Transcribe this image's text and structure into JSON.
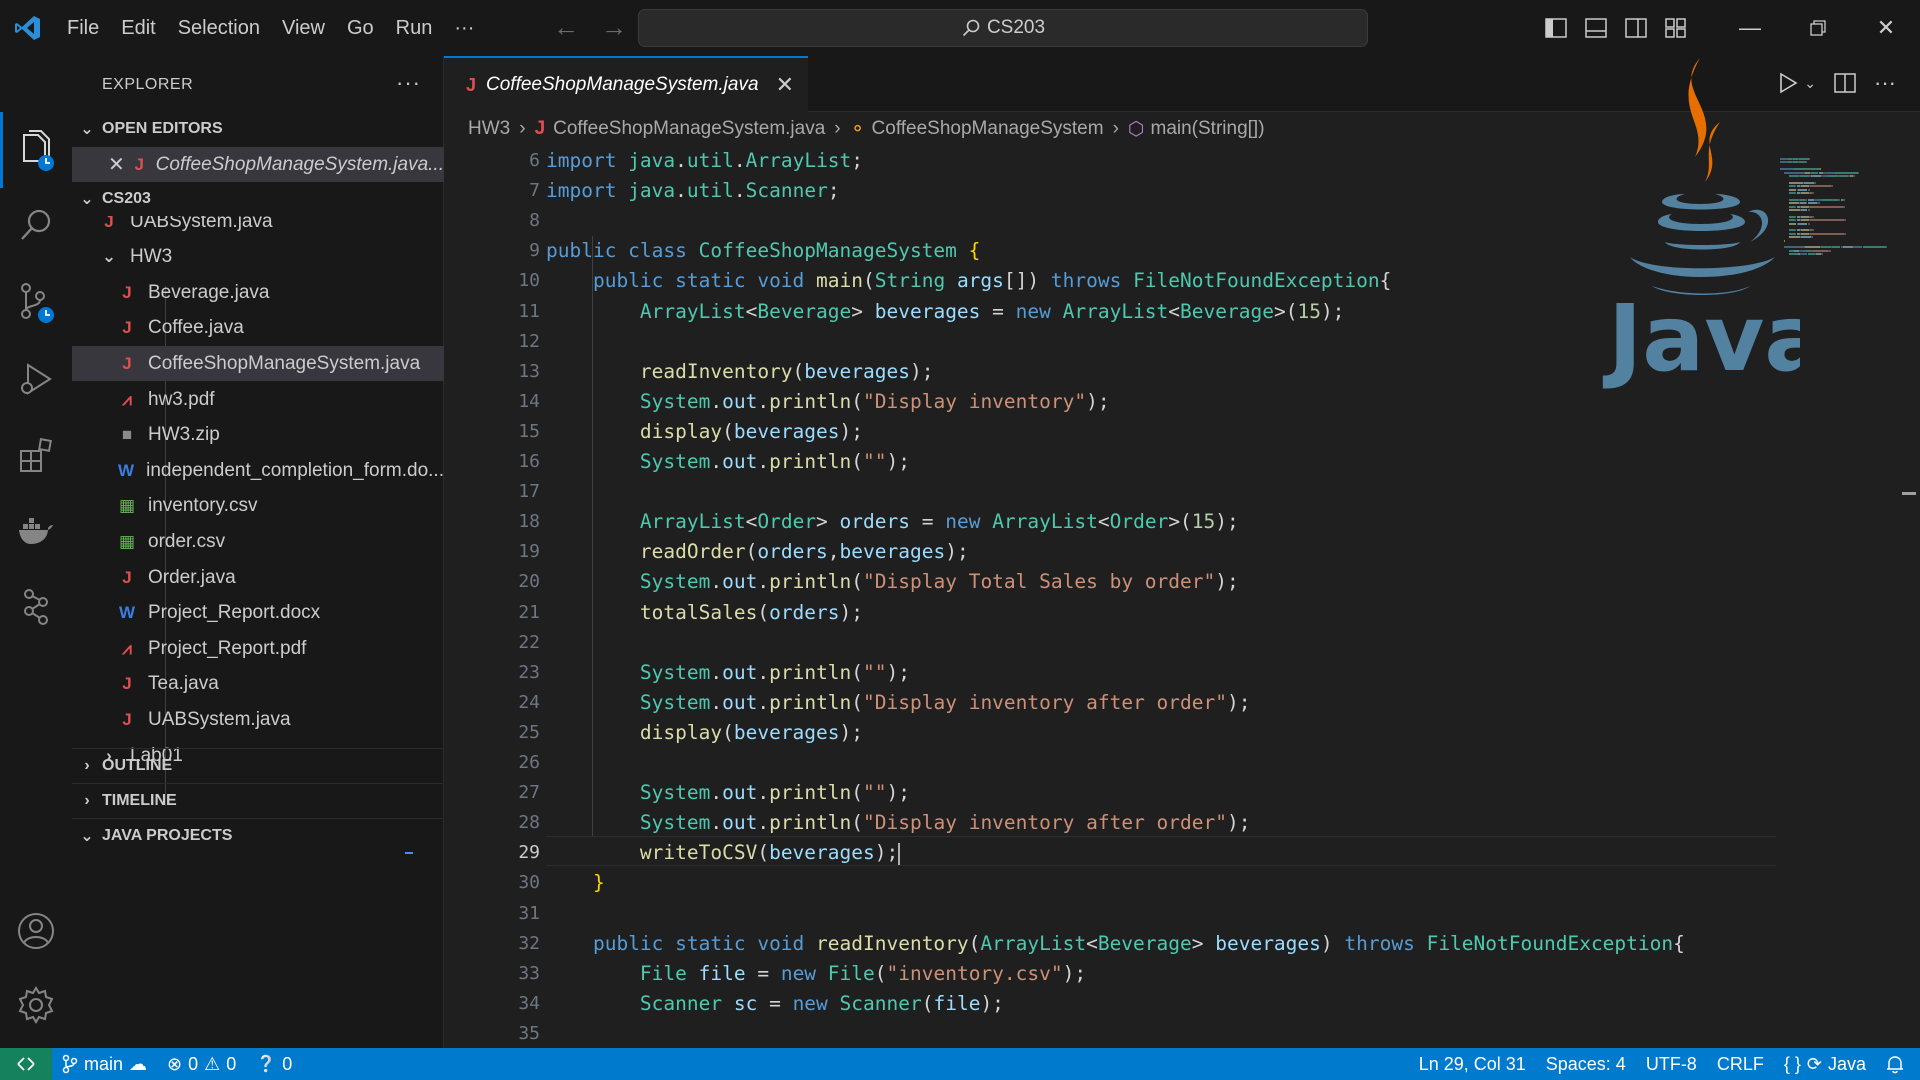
{
  "titlebar": {
    "menu": [
      "File",
      "Edit",
      "Selection",
      "View",
      "Go",
      "Run",
      "···"
    ],
    "search": "CS203"
  },
  "sidebar": {
    "header": "EXPLORER",
    "open_editors_label": "OPEN EDITORS",
    "open_editor_file": "CoffeeShopManageSystem.java...",
    "workspace_label": "CS203",
    "rows": [
      {
        "label": "UABSystem.java",
        "type": "java"
      },
      {
        "label": "HW3",
        "type": "folder"
      },
      {
        "label": "Beverage.java",
        "type": "java"
      },
      {
        "label": "Coffee.java",
        "type": "java"
      },
      {
        "label": "CoffeeShopManageSystem.java",
        "type": "java"
      },
      {
        "label": "hw3.pdf",
        "type": "pdf"
      },
      {
        "label": "HW3.zip",
        "type": "zip"
      },
      {
        "label": "independent_completion_form.do...",
        "type": "word"
      },
      {
        "label": "inventory.csv",
        "type": "csv"
      },
      {
        "label": "order.csv",
        "type": "csv"
      },
      {
        "label": "Order.java",
        "type": "java"
      },
      {
        "label": "Project_Report.docx",
        "type": "word"
      },
      {
        "label": "Project_Report.pdf",
        "type": "pdf"
      },
      {
        "label": "Tea.java",
        "type": "java"
      },
      {
        "label": "UABSystem.java",
        "type": "java"
      },
      {
        "label": "Lab01",
        "type": "folder-collapsed"
      }
    ],
    "outline_label": "OUTLINE",
    "timeline_label": "TIMELINE",
    "java_projects_label": "JAVA PROJECTS"
  },
  "editor": {
    "tab_label": "CoffeeShopManageSystem.java",
    "breadcrumbs": [
      "HW3",
      "CoffeeShopManageSystem.java",
      "CoffeeShopManageSystem",
      "main(String[])"
    ],
    "active_line": 29,
    "line_numbers": [
      "6",
      "7",
      "8",
      "9",
      "10",
      "11",
      "12",
      "13",
      "14",
      "15",
      "16",
      "17",
      "18",
      "19",
      "20",
      "21",
      "22",
      "23",
      "24",
      "25",
      "26",
      "27",
      "28",
      "29",
      "30",
      "31",
      "32",
      "33",
      "34",
      "35"
    ],
    "code": [
      [
        [
          "kw",
          "import "
        ],
        [
          "ty",
          "java"
        ],
        [
          "tx",
          "."
        ],
        [
          "ty",
          "util"
        ],
        [
          "tx",
          "."
        ],
        [
          "ty",
          "ArrayList"
        ],
        [
          "tx",
          ";"
        ]
      ],
      [
        [
          "kw",
          "import "
        ],
        [
          "ty",
          "java"
        ],
        [
          "tx",
          "."
        ],
        [
          "ty",
          "util"
        ],
        [
          "tx",
          "."
        ],
        [
          "ty",
          "Scanner"
        ],
        [
          "tx",
          ";"
        ]
      ],
      [],
      [
        [
          "kw",
          "public class "
        ],
        [
          "ty",
          "CoffeeShopManageSystem "
        ],
        [
          "br",
          "{"
        ]
      ],
      [
        [
          "tx",
          "    "
        ],
        [
          "kw",
          "public static void "
        ],
        [
          "fn",
          "main"
        ],
        [
          "tx",
          "("
        ],
        [
          "ty",
          "String "
        ],
        [
          "va",
          "args"
        ],
        [
          "tx",
          "[]) "
        ],
        [
          "kw",
          "throws "
        ],
        [
          "ty",
          "FileNotFoundException"
        ],
        [
          "tx",
          "{"
        ]
      ],
      [
        [
          "tx",
          "        "
        ],
        [
          "ty",
          "ArrayList"
        ],
        [
          "tx",
          "<"
        ],
        [
          "ty",
          "Beverage"
        ],
        [
          "tx",
          "> "
        ],
        [
          "va",
          "beverages"
        ],
        [
          "tx",
          " = "
        ],
        [
          "kw",
          "new "
        ],
        [
          "ty",
          "ArrayList"
        ],
        [
          "tx",
          "<"
        ],
        [
          "ty",
          "Beverage"
        ],
        [
          "tx",
          ">("
        ],
        [
          "nm",
          "15"
        ],
        [
          "tx",
          ");"
        ]
      ],
      [],
      [
        [
          "tx",
          "        "
        ],
        [
          "fn",
          "readInventory"
        ],
        [
          "tx",
          "("
        ],
        [
          "va",
          "beverages"
        ],
        [
          "tx",
          ");"
        ]
      ],
      [
        [
          "tx",
          "        "
        ],
        [
          "ty",
          "System"
        ],
        [
          "tx",
          "."
        ],
        [
          "va",
          "out"
        ],
        [
          "tx",
          "."
        ],
        [
          "fn",
          "println"
        ],
        [
          "tx",
          "("
        ],
        [
          "st",
          "\"Display inventory\""
        ],
        [
          "tx",
          ");"
        ]
      ],
      [
        [
          "tx",
          "        "
        ],
        [
          "fn",
          "display"
        ],
        [
          "tx",
          "("
        ],
        [
          "va",
          "beverages"
        ],
        [
          "tx",
          ");"
        ]
      ],
      [
        [
          "tx",
          "        "
        ],
        [
          "ty",
          "System"
        ],
        [
          "tx",
          "."
        ],
        [
          "va",
          "out"
        ],
        [
          "tx",
          "."
        ],
        [
          "fn",
          "println"
        ],
        [
          "tx",
          "("
        ],
        [
          "st",
          "\"\""
        ],
        [
          "tx",
          ");"
        ]
      ],
      [],
      [
        [
          "tx",
          "        "
        ],
        [
          "ty",
          "ArrayList"
        ],
        [
          "tx",
          "<"
        ],
        [
          "ty",
          "Order"
        ],
        [
          "tx",
          "> "
        ],
        [
          "va",
          "orders"
        ],
        [
          "tx",
          " = "
        ],
        [
          "kw",
          "new "
        ],
        [
          "ty",
          "ArrayList"
        ],
        [
          "tx",
          "<"
        ],
        [
          "ty",
          "Order"
        ],
        [
          "tx",
          ">("
        ],
        [
          "nm",
          "15"
        ],
        [
          "tx",
          ");"
        ]
      ],
      [
        [
          "tx",
          "        "
        ],
        [
          "fn",
          "readOrder"
        ],
        [
          "tx",
          "("
        ],
        [
          "va",
          "orders"
        ],
        [
          "tx",
          ","
        ],
        [
          "va",
          "beverages"
        ],
        [
          "tx",
          ");"
        ]
      ],
      [
        [
          "tx",
          "        "
        ],
        [
          "ty",
          "System"
        ],
        [
          "tx",
          "."
        ],
        [
          "va",
          "out"
        ],
        [
          "tx",
          "."
        ],
        [
          "fn",
          "println"
        ],
        [
          "tx",
          "("
        ],
        [
          "st",
          "\"Display Total Sales by order\""
        ],
        [
          "tx",
          ");"
        ]
      ],
      [
        [
          "tx",
          "        "
        ],
        [
          "fn",
          "totalSales"
        ],
        [
          "tx",
          "("
        ],
        [
          "va",
          "orders"
        ],
        [
          "tx",
          ");"
        ]
      ],
      [],
      [
        [
          "tx",
          "        "
        ],
        [
          "ty",
          "System"
        ],
        [
          "tx",
          "."
        ],
        [
          "va",
          "out"
        ],
        [
          "tx",
          "."
        ],
        [
          "fn",
          "println"
        ],
        [
          "tx",
          "("
        ],
        [
          "st",
          "\"\""
        ],
        [
          "tx",
          ");"
        ]
      ],
      [
        [
          "tx",
          "        "
        ],
        [
          "ty",
          "System"
        ],
        [
          "tx",
          "."
        ],
        [
          "va",
          "out"
        ],
        [
          "tx",
          "."
        ],
        [
          "fn",
          "println"
        ],
        [
          "tx",
          "("
        ],
        [
          "st",
          "\"Display inventory after order\""
        ],
        [
          "tx",
          ");"
        ]
      ],
      [
        [
          "tx",
          "        "
        ],
        [
          "fn",
          "display"
        ],
        [
          "tx",
          "("
        ],
        [
          "va",
          "beverages"
        ],
        [
          "tx",
          ");"
        ]
      ],
      [],
      [
        [
          "tx",
          "        "
        ],
        [
          "ty",
          "System"
        ],
        [
          "tx",
          "."
        ],
        [
          "va",
          "out"
        ],
        [
          "tx",
          "."
        ],
        [
          "fn",
          "println"
        ],
        [
          "tx",
          "("
        ],
        [
          "st",
          "\"\""
        ],
        [
          "tx",
          ");"
        ]
      ],
      [
        [
          "tx",
          "        "
        ],
        [
          "ty",
          "System"
        ],
        [
          "tx",
          "."
        ],
        [
          "va",
          "out"
        ],
        [
          "tx",
          "."
        ],
        [
          "fn",
          "println"
        ],
        [
          "tx",
          "("
        ],
        [
          "st",
          "\"Display inventory after order\""
        ],
        [
          "tx",
          ");"
        ]
      ],
      [
        [
          "tx",
          "        "
        ],
        [
          "fn",
          "writeToCSV"
        ],
        [
          "tx",
          "("
        ],
        [
          "va",
          "beverages"
        ],
        [
          "tx",
          ");"
        ]
      ],
      [
        [
          "tx",
          "    "
        ],
        [
          "br",
          "}"
        ]
      ],
      [],
      [
        [
          "tx",
          "    "
        ],
        [
          "kw",
          "public static void "
        ],
        [
          "fn",
          "readInventory"
        ],
        [
          "tx",
          "("
        ],
        [
          "ty",
          "ArrayList"
        ],
        [
          "tx",
          "<"
        ],
        [
          "ty",
          "Beverage"
        ],
        [
          "tx",
          "> "
        ],
        [
          "va",
          "beverages"
        ],
        [
          "tx",
          ") "
        ],
        [
          "kw",
          "throws "
        ],
        [
          "ty",
          "FileNotFoundException"
        ],
        [
          "tx",
          "{"
        ]
      ],
      [
        [
          "tx",
          "        "
        ],
        [
          "ty",
          "File "
        ],
        [
          "va",
          "file"
        ],
        [
          "tx",
          " = "
        ],
        [
          "kw",
          "new "
        ],
        [
          "ty",
          "File"
        ],
        [
          "tx",
          "("
        ],
        [
          "st",
          "\"inventory.csv\""
        ],
        [
          "tx",
          ");"
        ]
      ],
      [
        [
          "tx",
          "        "
        ],
        [
          "ty",
          "Scanner "
        ],
        [
          "va",
          "sc"
        ],
        [
          "tx",
          " = "
        ],
        [
          "kw",
          "new "
        ],
        [
          "ty",
          "Scanner"
        ],
        [
          "tx",
          "("
        ],
        [
          "va",
          "file"
        ],
        [
          "tx",
          ");"
        ]
      ],
      []
    ]
  },
  "overlay": {
    "java_logo_text": "Java"
  },
  "statusbar": {
    "branch": "main",
    "errors": "0",
    "warnings": "0",
    "ports": "0",
    "position": "Ln 29, Col 31",
    "spaces": "Spaces: 4",
    "encoding": "UTF-8",
    "eol": "CRLF",
    "language": "Java"
  },
  "colors": {
    "accent": "#0078d4",
    "statusbar": "#007acc",
    "java_orange": "#e76f00",
    "java_blue": "#5382a1"
  }
}
